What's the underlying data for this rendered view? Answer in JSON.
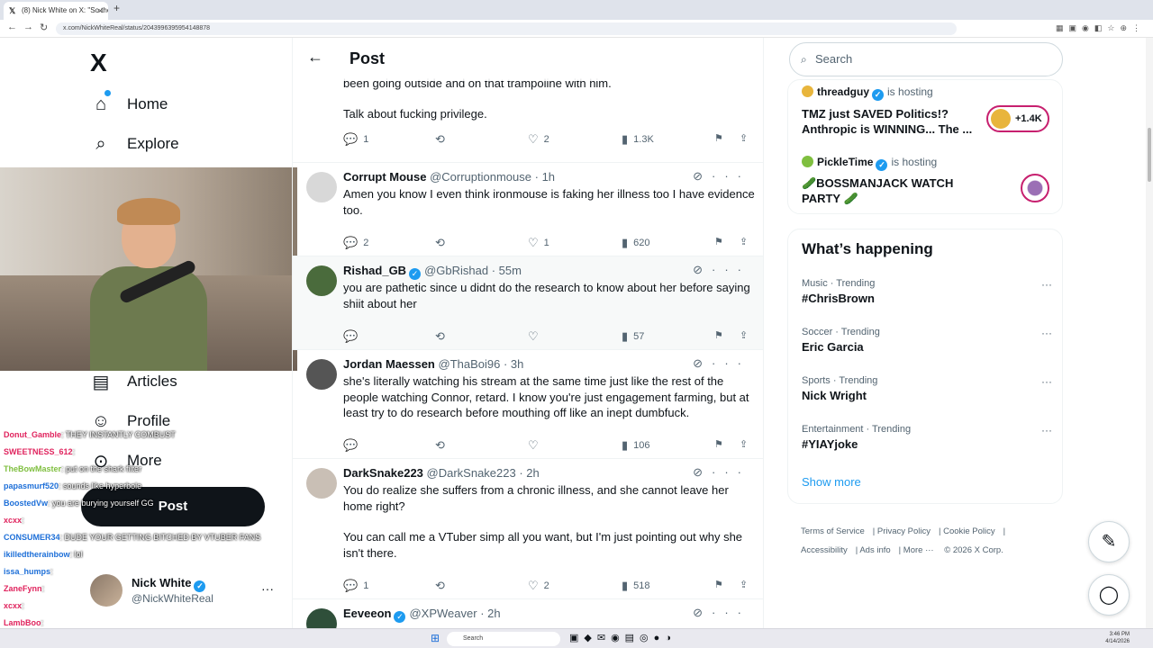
{
  "browser": {
    "tab_title": "(8) Nick White on X: \"So there",
    "tab_close": "×",
    "tab_new": "+",
    "url": "x.com/NickWhiteReal/status/2043996395954148878"
  },
  "nav": {
    "logo": "X",
    "home": "Home",
    "explore": "Explore",
    "articles": "Articles",
    "profile": "Profile",
    "more": "More",
    "post_button": "Post"
  },
  "account": {
    "name": "Nick White",
    "handle": "@NickWhiteReal",
    "menu": "···"
  },
  "chat": [
    {
      "user": "Donut_Gamble",
      "color": "#e0245e",
      "msg": ": THEY INSTANTLY COMBUST"
    },
    {
      "user": "SWEETNESS_612",
      "color": "#e0245e",
      "msg": ":"
    },
    {
      "user": "TheBowMaster",
      "color": "#7fbf3f",
      "msg": ": put on the shark filter"
    },
    {
      "user": "papasmurf520",
      "color": "#1d6fd8",
      "msg": ": sounds like hyperbole"
    },
    {
      "user": "BoostedVw",
      "color": "#1d6fd8",
      "msg": ": you are burying yourself GG"
    },
    {
      "user": "xcxx",
      "color": "#e0245e",
      "msg": ":"
    },
    {
      "user": "CONSUMER34",
      "color": "#1d6fd8",
      "msg": ": DUDE YOUR GETTING BITCHED BY VTUBER FANS"
    },
    {
      "user": "ikilledtherainbow",
      "color": "#1d6fd8",
      "msg": ": lol"
    },
    {
      "user": "issa_humps",
      "color": "#1d6fd8",
      "msg": ":"
    },
    {
      "user": "ZaneFynn",
      "color": "#e0245e",
      "msg": ":"
    },
    {
      "user": "xcxx",
      "color": "#e0245e",
      "msg": ":"
    },
    {
      "user": "LambBoo",
      "color": "#e0245e",
      "msg": ":"
    }
  ],
  "main": {
    "back": "←",
    "title": "Post",
    "prev_text_1": "been going outside and on that trampoline with him.",
    "prev_text_2": "Talk about fucking privilege.",
    "prev_stats": {
      "replies": "1",
      "likes": "2",
      "views": "1.3K"
    }
  },
  "tweets": [
    {
      "name": "Corrupt Mouse",
      "handle": "@Corruptionmouse",
      "time": "· 1h",
      "verified": false,
      "lines": [
        "Amen you know I even think ironmouse is faking her illness too I have evidence too."
      ],
      "replies": "2",
      "reposts": "",
      "likes": "1",
      "views": "620",
      "avatar_color": "#d8d8d8"
    },
    {
      "name": "Rishad_GB",
      "handle": "@GbRishad",
      "time": "· 55m",
      "verified": true,
      "lines": [
        "you are pathetic since u didnt do the research to know about her before saying shiit about her"
      ],
      "replies": "",
      "reposts": "",
      "likes": "",
      "views": "57",
      "avatar_color": "#4a6b3c"
    },
    {
      "name": "Jordan Maessen",
      "handle": "@ThaBoi96",
      "time": "· 3h",
      "verified": false,
      "lines": [
        "she's literally watching his stream at the same time just like the rest of the people watching Connor, retard. I know you're just engagement farming, but at least try to do research before mouthing off like an inept dumbfuck."
      ],
      "replies": "",
      "reposts": "",
      "likes": "",
      "views": "106",
      "avatar_color": "#555555"
    },
    {
      "name": "DarkSnake223",
      "handle": "@DarkSnake223",
      "time": "· 2h",
      "verified": false,
      "lines": [
        "You do realize she suffers from a chronic illness, and she cannot leave her home right?",
        "You can call me a VTuber simp all you want, but I'm just pointing out why she isn't there."
      ],
      "replies": "1",
      "reposts": "",
      "likes": "2",
      "views": "518",
      "avatar_color": "#c9bfb5"
    },
    {
      "name": "Eeveeon",
      "handle": "@XPWeaver",
      "time": "· 2h",
      "verified": true,
      "lines": [],
      "replies": "",
      "reposts": "",
      "likes": "",
      "views": "",
      "avatar_color": "#2f4f3a"
    }
  ],
  "right": {
    "search_placeholder": "Search",
    "spaces": [
      {
        "host": "threadguy",
        "hosting": "is hosting",
        "title": "TMZ just SAVED Politics!? Anthropic is WINNING... The ...",
        "listeners": "+1.4K"
      },
      {
        "host": "PickleTime",
        "hosting": "is hosting",
        "title": "🥒BOSSMANJACK WATCH PARTY 🥒"
      }
    ],
    "trends_title": "What’s happening",
    "trends": [
      {
        "category": "Music · Trending",
        "name": "#ChrisBrown"
      },
      {
        "category": "Soccer · Trending",
        "name": "Eric Garcia"
      },
      {
        "category": "Sports · Trending",
        "name": "Nick Wright"
      },
      {
        "category": "Entertainment · Trending",
        "name": "#YIAYjoke"
      }
    ],
    "show_more": "Show more",
    "footer": [
      "Terms of Service",
      "Privacy Policy",
      "Cookie Policy",
      "Accessibility",
      "Ads info",
      "More ···",
      "© 2026 X Corp."
    ]
  },
  "taskbar": {
    "search": "Search",
    "time": "3:46 PM",
    "date": "4/14/2026"
  },
  "colors": {
    "accent": "#1d9bf0",
    "text": "#0f1419",
    "muted": "#536471",
    "live_ring": "#c7206f"
  }
}
